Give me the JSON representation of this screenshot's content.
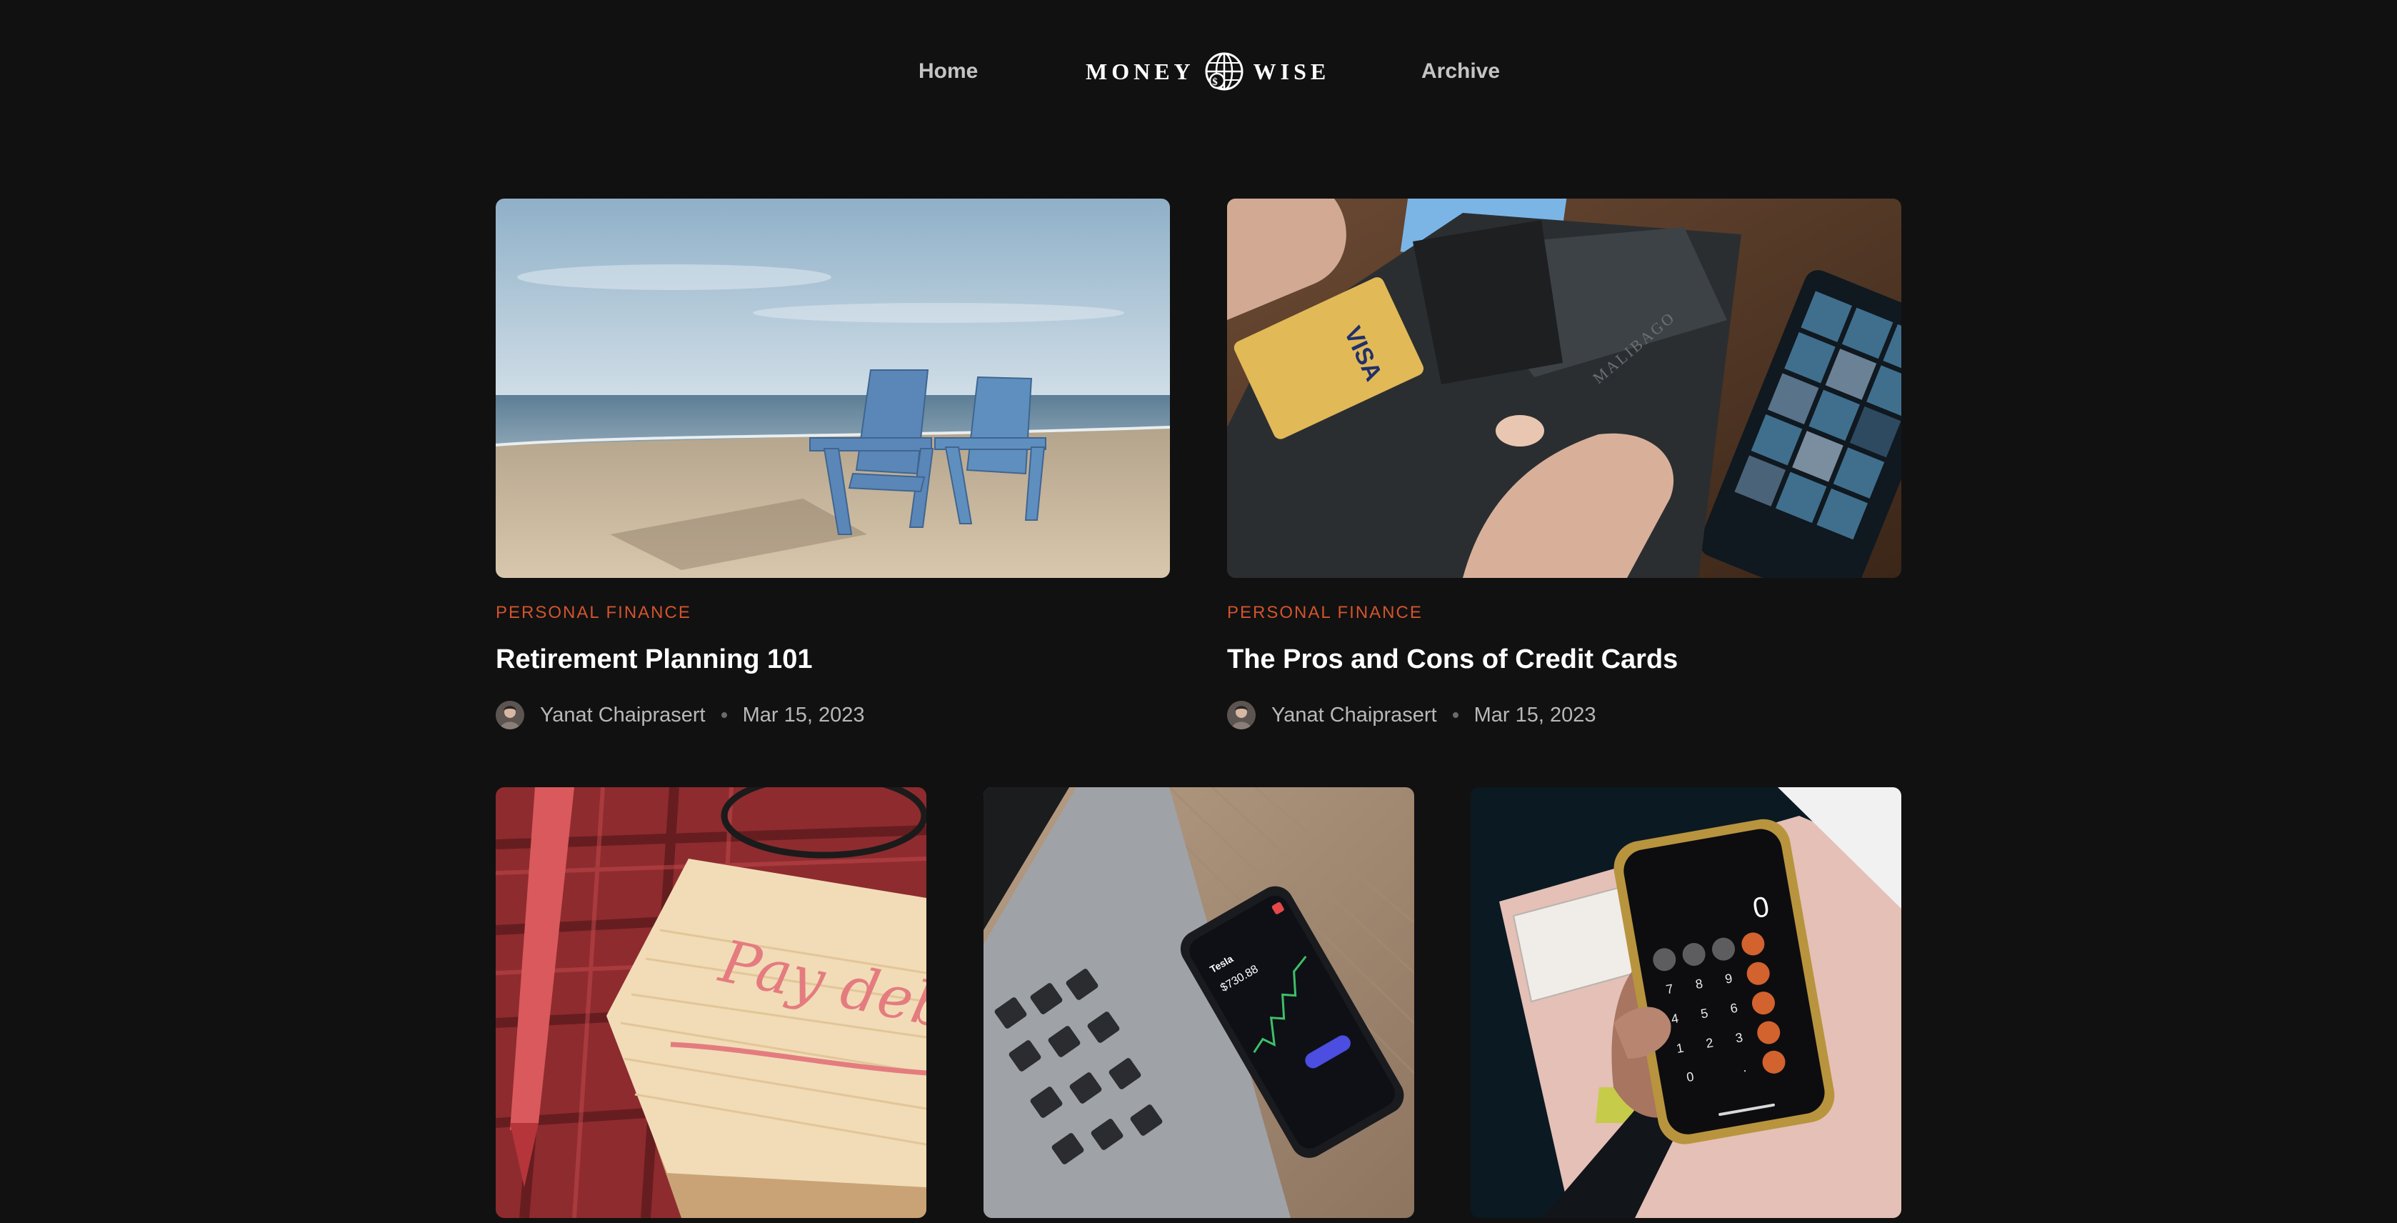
{
  "nav": {
    "home": "Home",
    "logo_left": "MONEY",
    "logo_right": "WISE",
    "archive": "Archive"
  },
  "colors": {
    "background": "#111111",
    "category": "#d2542d",
    "nav_text": "#c4c4c4",
    "meta_text": "#b8b8b8"
  },
  "posts": [
    {
      "image": "beach-chairs-photo",
      "category": "PERSONAL FINANCE",
      "title": "Retirement Planning 101",
      "author": "Yanat Chaiprasert",
      "date": "Mar 15, 2023"
    },
    {
      "image": "wallet-credit-card-photo",
      "category": "PERSONAL FINANCE",
      "title": "The Pros and Cons of Credit Cards",
      "author": "Yanat Chaiprasert",
      "date": "Mar 15, 2023"
    },
    {
      "image": "pay-debt-note-photo",
      "note_text": "Pay deb"
    },
    {
      "image": "stock-app-phone-photo"
    },
    {
      "image": "calculator-phone-photo",
      "display": "0"
    }
  ]
}
